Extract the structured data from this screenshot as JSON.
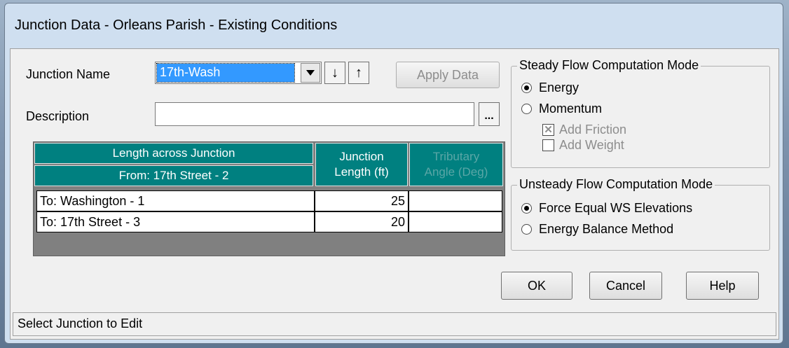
{
  "window": {
    "title": "Junction Data - Orleans Parish - Existing Conditions"
  },
  "form": {
    "junction_name_label": "Junction Name",
    "junction_name_value": "17th-Wash",
    "description_label": "Description",
    "description_value": "",
    "down_arrow": "↓",
    "up_arrow": "↑",
    "apply_label": "Apply Data",
    "ellipsis_label": "..."
  },
  "table": {
    "col1_header": "Length across Junction",
    "col1_sub": "From: 17th Street - 2",
    "col2_header_line1": "Junction",
    "col2_header_line2": "Length (ft)",
    "col3_header_line1": "Tributary",
    "col3_header_line2": "Angle (Deg)",
    "rows": [
      {
        "to": "To: Washington - 1",
        "length": "25",
        "angle": ""
      },
      {
        "to": "To: 17th Street - 3",
        "length": "20",
        "angle": ""
      }
    ]
  },
  "steady": {
    "title": "Steady Flow Computation Mode",
    "energy_label": "Energy",
    "momentum_label": "Momentum",
    "add_friction_label": "Add Friction",
    "add_weight_label": "Add Weight",
    "selected": "Energy",
    "add_friction_checked": true,
    "add_weight_checked": false
  },
  "unsteady": {
    "title": "Unsteady Flow Computation Mode",
    "force_label": "Force Equal WS Elevations",
    "energy_balance_label": "Energy Balance Method",
    "selected": "Force Equal WS Elevations"
  },
  "buttons": {
    "ok": "OK",
    "cancel": "Cancel",
    "help": "Help"
  },
  "status": {
    "text": "Select Junction to Edit"
  }
}
